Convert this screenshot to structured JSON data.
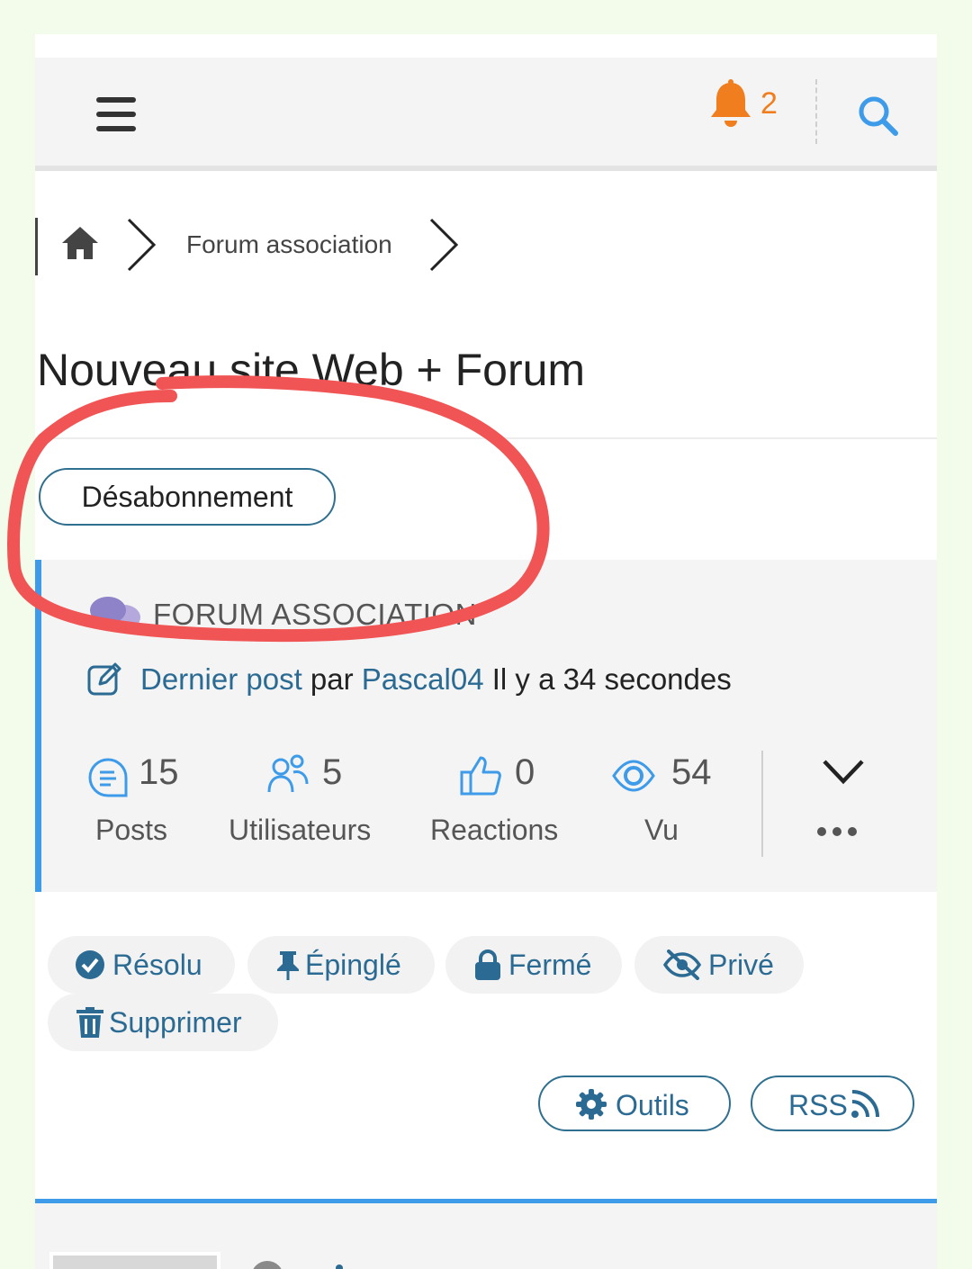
{
  "header": {
    "notification_count": "2",
    "icons": [
      "menu-icon",
      "bell-icon",
      "search-icon"
    ],
    "accent_color": "#f07d1e"
  },
  "breadcrumb": {
    "items": [
      "Forum association"
    ]
  },
  "topic": {
    "title": "Nouveau site Web + Forum",
    "unsubscribe_label": "Désabonnement"
  },
  "card": {
    "forum_name": "FORUM ASSOCIATION",
    "last_post": {
      "link_label": "Dernier post",
      "by": "par",
      "author": "Pascal04",
      "time": "Il y a 34 secondes"
    },
    "stats": [
      {
        "value": "15",
        "label": "Posts"
      },
      {
        "value": "5",
        "label": "Utilisateurs"
      },
      {
        "value": "0",
        "label": "Reactions"
      },
      {
        "value": "54",
        "label": "Vu"
      }
    ]
  },
  "actions": {
    "resolve": "Résolu",
    "pin": "Épinglé",
    "close": "Fermé",
    "private": "Privé",
    "delete": "Supprimer"
  },
  "tools": {
    "tools_label": "Outils",
    "rss_label": "RSS"
  },
  "colors": {
    "link": "#2b6a92",
    "card_accent": "#3d9be9",
    "annotation": "#f05454"
  }
}
